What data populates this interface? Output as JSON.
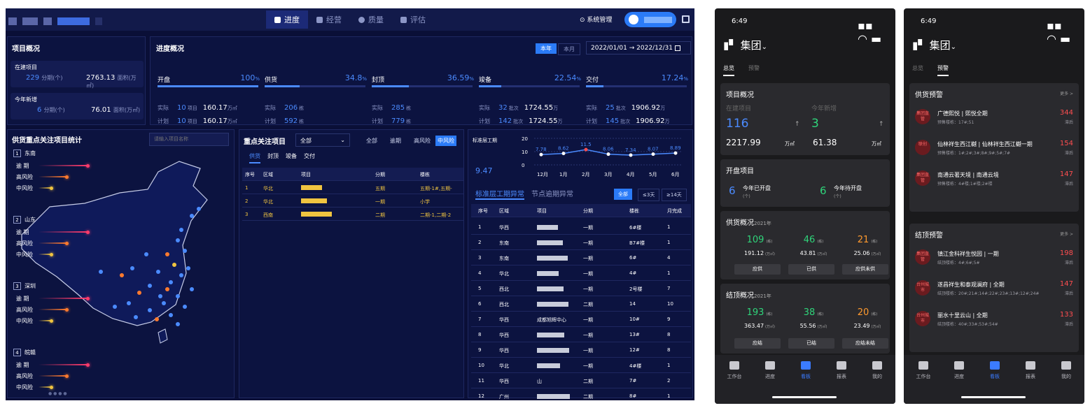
{
  "colors": {
    "accent": "#4b8bff",
    "danger": "#ff4d4f",
    "orange": "#ff7a2e",
    "green": "#2fd47a",
    "yellow": "#f0c440"
  },
  "nav": {
    "tabs": [
      {
        "label": "进度",
        "icon": "progress-icon"
      },
      {
        "label": "经营",
        "icon": "business-icon"
      },
      {
        "label": "质量",
        "icon": "quality-icon"
      },
      {
        "label": "评估",
        "icon": "evaluate-icon"
      }
    ],
    "system": "系统管理"
  },
  "overview": {
    "title": "项目概况",
    "building": {
      "label": "在建项目",
      "count": "229",
      "count_unit": "分期(个)",
      "area": "2763.13",
      "area_unit": "面积(万㎡)"
    },
    "new": {
      "label": "今年新增",
      "count": "6",
      "count_unit": "分期(个)",
      "area": "76.01",
      "area_unit": "面积(万㎡)"
    }
  },
  "progress": {
    "title": "进度概况",
    "toggle": [
      "本年",
      "本月"
    ],
    "date_range": "2022/01/01 → 2022/12/31",
    "kpis": [
      {
        "name": "开盘",
        "pct": "100",
        "fill": 1.0,
        "actual": "10",
        "actual_unit": "项目",
        "actual_area": "160.17",
        "plan": "10",
        "plan_unit": "项目",
        "plan_area": "160.17",
        "area_unit": "万㎡"
      },
      {
        "name": "供货",
        "pct": "34.8",
        "fill": 0.348,
        "actual": "206",
        "actual_unit": "栋",
        "actual_area": "",
        "plan": "592",
        "plan_unit": "栋",
        "plan_area": "",
        "area_unit": ""
      },
      {
        "name": "封顶",
        "pct": "36.59",
        "fill": 0.3659,
        "actual": "285",
        "actual_unit": "栋",
        "actual_area": "",
        "plan": "779",
        "plan_unit": "栋",
        "plan_area": "",
        "area_unit": ""
      },
      {
        "name": "竣备",
        "pct": "22.54",
        "fill": 0.2254,
        "actual": "32",
        "actual_unit": "批次",
        "actual_area": "1724.55",
        "plan": "142",
        "plan_unit": "批次",
        "plan_area": "1724.55",
        "area_unit": "万"
      },
      {
        "name": "交付",
        "pct": "17.24",
        "fill": 0.1724,
        "actual": "25",
        "actual_unit": "批次",
        "actual_area": "1906.92",
        "plan": "145",
        "plan_unit": "批次",
        "plan_area": "1906.92",
        "area_unit": "万"
      }
    ],
    "actual_label": "实际",
    "plan_label": "计划"
  },
  "supply": {
    "title": "供货重点关注项目统计",
    "search_placeholder": "请输入项目名称",
    "groups": [
      {
        "idx": "1",
        "name": "东南"
      },
      {
        "idx": "2",
        "name": "山东"
      },
      {
        "idx": "3",
        "name": "深圳"
      },
      {
        "idx": "4",
        "name": "皖赣"
      }
    ],
    "labels": {
      "overdue": "逾 期",
      "high": "高风险",
      "mid": "中风险"
    }
  },
  "focus": {
    "title": "重点关注项目",
    "select": "全部",
    "filters": [
      "全部",
      "逾期",
      "高风险",
      "中风险"
    ],
    "tabs": [
      "供货",
      "封顶",
      "竣备",
      "交付"
    ],
    "headers": [
      "序号",
      "区域",
      "项目",
      "分期",
      "楼栋"
    ],
    "rows": [
      [
        "1",
        "华北",
        "",
        "五期",
        "五期-1#,五期-"
      ],
      [
        "2",
        "华北",
        "",
        "一期",
        "小学"
      ],
      [
        "3",
        "西南",
        "",
        "二期",
        "二期-1,二期-2"
      ]
    ]
  },
  "std": {
    "label": "标准层工期",
    "avg": "9.47",
    "yticks": [
      "20",
      "10",
      "0"
    ],
    "months": [
      "12月",
      "1月",
      "2月",
      "3月",
      "4月",
      "5月",
      "6月"
    ],
    "tabs": [
      "标准层工期异常",
      "节点逾期异常"
    ],
    "filters": [
      "全部",
      "≤3天",
      "≥14天"
    ],
    "headers": [
      "序号",
      "区域",
      "项目",
      "分期",
      "楼栋",
      "月完成"
    ],
    "rows": [
      [
        "1",
        "华西",
        "",
        "一期",
        "6#楼",
        "1"
      ],
      [
        "2",
        "东南",
        "",
        "一期",
        "B7#楼",
        "1"
      ],
      [
        "3",
        "东南",
        "",
        "一期",
        "6#",
        "4"
      ],
      [
        "4",
        "华北",
        "",
        "一期",
        "4#",
        "1"
      ],
      [
        "5",
        "西北",
        "",
        "一期",
        "2号楼",
        "7"
      ],
      [
        "6",
        "西北",
        "",
        "二期",
        "14",
        "10"
      ],
      [
        "7",
        "华西",
        "成都旭辉中心",
        "一期",
        "10#",
        "9"
      ],
      [
        "8",
        "华西",
        "",
        "一期",
        "13#",
        "8"
      ],
      [
        "9",
        "华西",
        "",
        "一期",
        "12#",
        "8"
      ],
      [
        "10",
        "华北",
        "",
        "一期",
        "4#楼",
        "1"
      ],
      [
        "11",
        "华西",
        "山",
        "二期",
        "7#",
        "2"
      ],
      [
        "12",
        "广州",
        "",
        "二期",
        "8#",
        "1"
      ]
    ]
  },
  "chart_data": {
    "type": "line",
    "categories": [
      "12月",
      "1月",
      "2月",
      "3月",
      "4月",
      "5月",
      "6月"
    ],
    "series": [
      {
        "values": [
          7.78,
          8.62,
          11.5,
          8.06,
          7.34,
          8.07,
          8.89
        ]
      }
    ],
    "ylim": [
      0,
      20
    ],
    "ylabel": "标准层工期"
  },
  "phone1": {
    "time": "6:49",
    "brand": "集团",
    "tabs": [
      "总览",
      "预警"
    ],
    "proj": {
      "title": "项目概况",
      "l1": "在建项目",
      "l2": "今年新增",
      "v1": "116",
      "v2": "3",
      "a1": "2217.99",
      "a2": "61.38",
      "unit": "万㎡"
    },
    "open": {
      "title": "开盘项目",
      "v1": "6",
      "l1": "今年已开盘",
      "v2": "6",
      "l2": "今年待开盘",
      "u": "(个)"
    },
    "supply": {
      "title": "供货概况",
      "year": "2021年",
      "v": [
        "109",
        "46",
        "21"
      ],
      "u": "(栋)",
      "a": [
        "191.12",
        "43.81",
        "25.06"
      ],
      "au": "(万㎡)",
      "btn": [
        "应供",
        "已供",
        "应供未供"
      ]
    },
    "top": {
      "title": "结顶概况",
      "year": "2021年",
      "v": [
        "193",
        "38",
        "20"
      ],
      "u": "(栋)",
      "a": [
        "363.47",
        "55.56",
        "23.49"
      ],
      "au": "(万㎡)",
      "btn": [
        "应结",
        "已结",
        "应结未结"
      ]
    },
    "nav": [
      "工作台",
      "进度",
      "看板",
      "报表",
      "我的"
    ]
  },
  "phone2": {
    "time": "6:49",
    "brand": "集团",
    "tabs": [
      "总览",
      "预警"
    ],
    "supply": {
      "title": "供货预警",
      "more": "更多 >",
      "items": [
        {
          "badge": "集团直管",
          "title": "广德熙悦 | 熙悦全期",
          "sub": "预售楼栋：17#;51",
          "num": "344",
          "st": "滞后"
        },
        {
          "badge": "联创",
          "title": "仙林祥生西江樾 | 仙林祥生西江樾一期",
          "sub": "预售楼栋：1#;2#;3#;8#;9#;5#;7#",
          "num": "154",
          "st": "滞后"
        },
        {
          "badge": "集团直管",
          "title": "南通云著天境 | 南通云境",
          "sub": "预售楼栋：4#楼;1#楼;2#楼",
          "num": "147",
          "st": "滞后"
        }
      ]
    },
    "top": {
      "title": "结顶预警",
      "more": "更多 >",
      "items": [
        {
          "badge": "集团直管",
          "title": "镇江金科祥生悦园 | 一期",
          "sub": "结顶楼栋：4#;6#;5#",
          "num": "198",
          "st": "滞后"
        },
        {
          "badge": "台州城市",
          "title": "遂昌祥生和泰观澜府 | 全期",
          "sub": "结顶楼栋：20#;21#;14#;22#;23#;13#;12#;24#",
          "num": "147",
          "st": "滞后"
        },
        {
          "badge": "台州城市",
          "title": "丽水十里云山 | 全期",
          "sub": "结顶楼栋：40#;33#;53#;54#",
          "num": "133",
          "st": "滞后"
        }
      ]
    },
    "nav": [
      "工作台",
      "进度",
      "看板",
      "报表",
      "我的"
    ]
  }
}
